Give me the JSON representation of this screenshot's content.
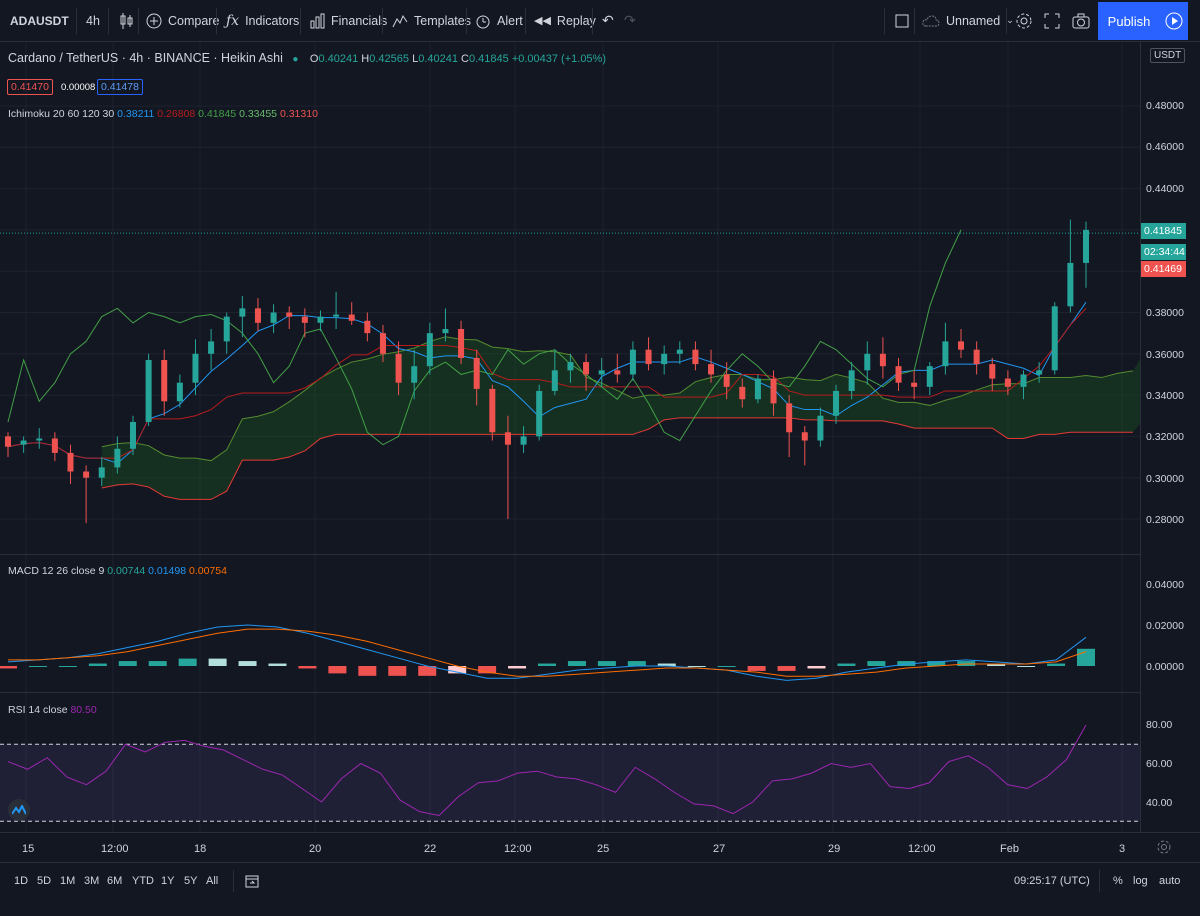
{
  "toolbar": {
    "symbol": "ADAUSDT",
    "interval": "4h",
    "compare": "Compare",
    "indicators": "Indicators",
    "financials": "Financials",
    "templates": "Templates",
    "alert": "Alert",
    "replay": "Replay",
    "layout_name": "Unnamed",
    "publish": "Publish"
  },
  "legend": {
    "title": "Cardano / TetherUS · 4h · BINANCE · Heikin Ashi",
    "o_label": "O",
    "o": "0.40241",
    "h_label": "H",
    "h": "0.42565",
    "l_label": "L",
    "l": "0.40241",
    "c_label": "C",
    "c": "0.41845",
    "change": "+0.00437 (+1.05%)",
    "bid": "0.41470",
    "spread": "0.00008",
    "ask": "0.41478",
    "ichimoku_name": "Ichimoku 20 60 120 30",
    "ichimoku_values": [
      "0.38211",
      "0.26808",
      "0.41845",
      "0.33455",
      "0.31310"
    ],
    "macd_name": "MACD 12 26 close 9",
    "macd_values": [
      "0.00744",
      "0.01498",
      "0.00754"
    ],
    "rsi_name": "RSI 14 close",
    "rsi_value": "80.50"
  },
  "price_axis": {
    "currency": "USDT",
    "ticks": [
      "0.48000",
      "0.46000",
      "0.44000",
      "0.38000",
      "0.36000",
      "0.34000",
      "0.32000",
      "0.30000",
      "0.28000"
    ],
    "last_price": "0.41845",
    "countdown": "02:34:44",
    "prev_close": "0.41469"
  },
  "macd_axis": [
    "0.04000",
    "0.02000",
    "0.00000"
  ],
  "rsi_axis": [
    "80.00",
    "60.00",
    "40.00"
  ],
  "time_axis": [
    "15",
    "12:00",
    "18",
    "20",
    "22",
    "12:00",
    "25",
    "27",
    "29",
    "12:00",
    "Feb",
    "3"
  ],
  "ranges": [
    "1D",
    "5D",
    "1M",
    "3M",
    "6M",
    "YTD",
    "1Y",
    "5Y",
    "All"
  ],
  "clock": "09:25:17 (UTC)",
  "scale_opts": [
    "%",
    "log",
    "auto"
  ],
  "colors": {
    "up": "#26a69a",
    "down": "#ef5350",
    "tenkan": "#2196f3",
    "kijun": "#b71c1c",
    "lagging": "#43a047",
    "spanA": "#558b2f",
    "spanB": "#e53935",
    "rsi": "#9c27b0",
    "signal": "#ff6d00",
    "bg": "#131722"
  },
  "chart_data": {
    "type": "candlestick",
    "series": [
      {
        "name": "ADAUSDT",
        "type": "heikin_ashi",
        "ohlc": [
          [
            0.32,
            0.322,
            0.31,
            0.315
          ],
          [
            0.316,
            0.32,
            0.312,
            0.318
          ],
          [
            0.318,
            0.324,
            0.314,
            0.319
          ],
          [
            0.319,
            0.322,
            0.308,
            0.312
          ],
          [
            0.312,
            0.316,
            0.297,
            0.303
          ],
          [
            0.303,
            0.306,
            0.278,
            0.3
          ],
          [
            0.3,
            0.31,
            0.296,
            0.305
          ],
          [
            0.305,
            0.32,
            0.302,
            0.314
          ],
          [
            0.314,
            0.33,
            0.311,
            0.327
          ],
          [
            0.327,
            0.36,
            0.325,
            0.357
          ],
          [
            0.357,
            0.362,
            0.33,
            0.337
          ],
          [
            0.337,
            0.35,
            0.334,
            0.346
          ],
          [
            0.346,
            0.367,
            0.34,
            0.36
          ],
          [
            0.36,
            0.372,
            0.352,
            0.366
          ],
          [
            0.366,
            0.38,
            0.36,
            0.378
          ],
          [
            0.378,
            0.388,
            0.368,
            0.382
          ],
          [
            0.382,
            0.387,
            0.371,
            0.375
          ],
          [
            0.375,
            0.384,
            0.37,
            0.38
          ],
          [
            0.38,
            0.383,
            0.372,
            0.378
          ],
          [
            0.378,
            0.382,
            0.368,
            0.375
          ],
          [
            0.375,
            0.381,
            0.371,
            0.378
          ],
          [
            0.378,
            0.39,
            0.372,
            0.379
          ],
          [
            0.379,
            0.385,
            0.374,
            0.376
          ],
          [
            0.376,
            0.38,
            0.366,
            0.37
          ],
          [
            0.37,
            0.374,
            0.356,
            0.36
          ],
          [
            0.36,
            0.366,
            0.34,
            0.346
          ],
          [
            0.346,
            0.362,
            0.338,
            0.354
          ],
          [
            0.354,
            0.375,
            0.35,
            0.37
          ],
          [
            0.37,
            0.382,
            0.366,
            0.372
          ],
          [
            0.372,
            0.376,
            0.355,
            0.358
          ],
          [
            0.358,
            0.362,
            0.335,
            0.343
          ],
          [
            0.343,
            0.345,
            0.318,
            0.322
          ],
          [
            0.322,
            0.33,
            0.28,
            0.316
          ],
          [
            0.316,
            0.325,
            0.312,
            0.32
          ],
          [
            0.32,
            0.345,
            0.318,
            0.342
          ],
          [
            0.342,
            0.362,
            0.34,
            0.352
          ],
          [
            0.352,
            0.36,
            0.346,
            0.356
          ],
          [
            0.356,
            0.36,
            0.342,
            0.35
          ],
          [
            0.35,
            0.358,
            0.344,
            0.352
          ],
          [
            0.352,
            0.36,
            0.346,
            0.35
          ],
          [
            0.35,
            0.366,
            0.347,
            0.362
          ],
          [
            0.362,
            0.368,
            0.352,
            0.355
          ],
          [
            0.355,
            0.364,
            0.35,
            0.36
          ],
          [
            0.36,
            0.366,
            0.355,
            0.362
          ],
          [
            0.362,
            0.366,
            0.352,
            0.355
          ],
          [
            0.355,
            0.362,
            0.346,
            0.35
          ],
          [
            0.35,
            0.356,
            0.338,
            0.344
          ],
          [
            0.344,
            0.348,
            0.334,
            0.338
          ],
          [
            0.338,
            0.35,
            0.336,
            0.348
          ],
          [
            0.348,
            0.352,
            0.33,
            0.336
          ],
          [
            0.336,
            0.34,
            0.31,
            0.322
          ],
          [
            0.322,
            0.325,
            0.306,
            0.318
          ],
          [
            0.318,
            0.334,
            0.315,
            0.33
          ],
          [
            0.33,
            0.345,
            0.326,
            0.342
          ],
          [
            0.342,
            0.356,
            0.338,
            0.352
          ],
          [
            0.352,
            0.366,
            0.345,
            0.36
          ],
          [
            0.36,
            0.368,
            0.348,
            0.354
          ],
          [
            0.354,
            0.358,
            0.342,
            0.346
          ],
          [
            0.346,
            0.352,
            0.338,
            0.344
          ],
          [
            0.344,
            0.356,
            0.34,
            0.354
          ],
          [
            0.354,
            0.375,
            0.35,
            0.366
          ],
          [
            0.366,
            0.372,
            0.358,
            0.362
          ],
          [
            0.362,
            0.366,
            0.35,
            0.355
          ],
          [
            0.355,
            0.358,
            0.342,
            0.348
          ],
          [
            0.348,
            0.352,
            0.34,
            0.344
          ],
          [
            0.344,
            0.352,
            0.338,
            0.35
          ],
          [
            0.35,
            0.356,
            0.346,
            0.352
          ],
          [
            0.352,
            0.385,
            0.35,
            0.383
          ],
          [
            0.383,
            0.425,
            0.38,
            0.404
          ],
          [
            0.404,
            0.424,
            0.392,
            0.42
          ]
        ]
      },
      {
        "name": "MACD",
        "values": [
          0.002,
          0.003,
          0.004,
          0.006,
          0.009,
          0.012,
          0.016,
          0.019,
          0.02,
          0.019,
          0.016,
          0.012,
          0.008,
          0.004,
          0.0,
          -0.003,
          -0.006,
          -0.006,
          -0.004,
          -0.002,
          -0.001,
          0.0,
          0.0,
          -0.001,
          -0.002,
          -0.005,
          -0.007,
          -0.006,
          -0.003,
          -0.001,
          0.001,
          0.002,
          0.003,
          0.002,
          0.001,
          0.003,
          0.014
        ]
      },
      {
        "name": "Signal",
        "values": [
          0.003,
          0.003,
          0.004,
          0.005,
          0.007,
          0.01,
          0.013,
          0.016,
          0.018,
          0.018,
          0.017,
          0.015,
          0.012,
          0.008,
          0.004,
          0.0,
          -0.003,
          -0.005,
          -0.005,
          -0.004,
          -0.003,
          -0.002,
          -0.001,
          -0.001,
          -0.002,
          -0.003,
          -0.005,
          -0.005,
          -0.004,
          -0.003,
          -0.001,
          0.0,
          0.001,
          0.001,
          0.001,
          0.002,
          0.007
        ]
      },
      {
        "name": "RSI",
        "values": [
          61,
          57,
          63,
          53,
          49,
          56,
          70,
          66,
          71,
          72,
          69,
          67,
          62,
          57,
          54,
          47,
          40,
          52,
          60,
          55,
          41,
          35,
          33,
          43,
          50,
          51,
          55,
          56,
          53,
          52,
          49,
          45,
          58,
          52,
          45,
          39,
          38,
          34,
          40,
          51,
          52,
          55,
          60,
          58,
          60,
          48,
          47,
          50,
          61,
          64,
          58,
          49,
          47,
          53,
          62,
          80
        ]
      }
    ],
    "ylim": [
      0.26,
      0.49
    ],
    "macd_ylim": [
      -0.01,
      0.045
    ],
    "rsi_ylim": [
      25,
      95
    ],
    "rsi_bands": [
      30,
      70
    ]
  }
}
